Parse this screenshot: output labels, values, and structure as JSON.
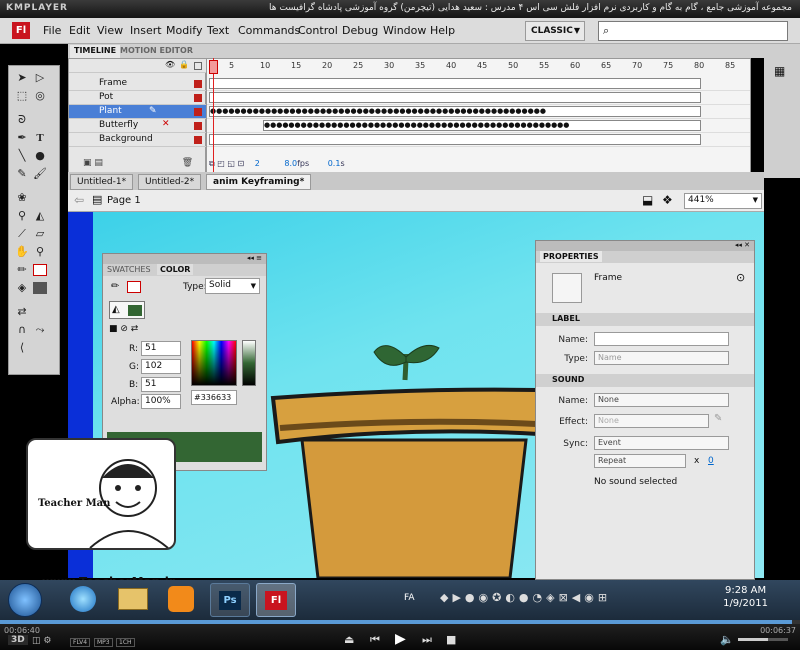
{
  "player": {
    "logo": "KMPLAYER",
    "title": "مجموعه آموزشی جامع ، گام به گام و کاربردی نرم افزار فلش سی اس ۴ مدرس : سعید هدایی (تیچرمن) گروه آموزشی پادشاه گرافیست ها"
  },
  "menu": {
    "app_logo": "Fl",
    "items": [
      "File",
      "Edit",
      "View",
      "Insert",
      "Modify",
      "Text",
      "Commands",
      "Control",
      "Debug",
      "Window",
      "Help"
    ],
    "workspace": "CLASSIC",
    "search_placeholder": ""
  },
  "timeline": {
    "tabs": [
      "TIMELINE",
      "MOTION EDITOR"
    ],
    "frame_numbers": [
      "5",
      "10",
      "15",
      "20",
      "25",
      "30",
      "35",
      "40",
      "45",
      "50",
      "55",
      "60",
      "65",
      "70",
      "75",
      "80",
      "85"
    ],
    "layers": [
      "Frame",
      "Pot",
      "Plant",
      "Butterfly",
      "Background"
    ],
    "selected_layer": "Plant",
    "status": {
      "frame": "2",
      "fps": "8.0",
      "fps_unit": "fps",
      "time": "0.1",
      "time_unit": "s"
    }
  },
  "documents": {
    "tabs": [
      "Untitled-1*",
      "Untitled-2*",
      "anim Keyframing*"
    ],
    "active": "anim Keyframing*",
    "scene": "Page 1",
    "zoom": "441%"
  },
  "color_panel": {
    "tabs": [
      "SWATCHES",
      "COLOR"
    ],
    "type_label": "Type:",
    "type_value": "Solid",
    "r_label": "R:",
    "r": "51",
    "g_label": "G:",
    "g": "102",
    "b_label": "B:",
    "b": "51",
    "alpha_label": "Alpha:",
    "alpha": "100%",
    "hex": "#336633",
    "swatch_color": "#336633"
  },
  "properties": {
    "tab": "PROPERTIES",
    "object": "Frame",
    "label_section": "LABEL",
    "name_label": "Name:",
    "type_label": "Type:",
    "type_value": "Name",
    "sound_section": "SOUND",
    "sound_name_label": "Name:",
    "sound_name": "None",
    "effect_label": "Effect:",
    "effect": "None",
    "sync_label": "Sync:",
    "sync": "Event",
    "repeat": "Repeat",
    "repeat_x": "x",
    "repeat_count": "0",
    "status": "No sound selected"
  },
  "watermark": {
    "site": "www.TeacherMan.ir",
    "brand": "Teacher Man"
  },
  "taskbar": {
    "lang": "FA",
    "time": "9:28 AM",
    "date": "1/9/2011",
    "apps": [
      "Ps",
      "Fl"
    ]
  },
  "km_controls": {
    "elapsed": "00:06:40",
    "total": "00:06:37",
    "mode_label": "3D",
    "badges": [
      "FLV4",
      "MP3",
      "1CH"
    ]
  }
}
